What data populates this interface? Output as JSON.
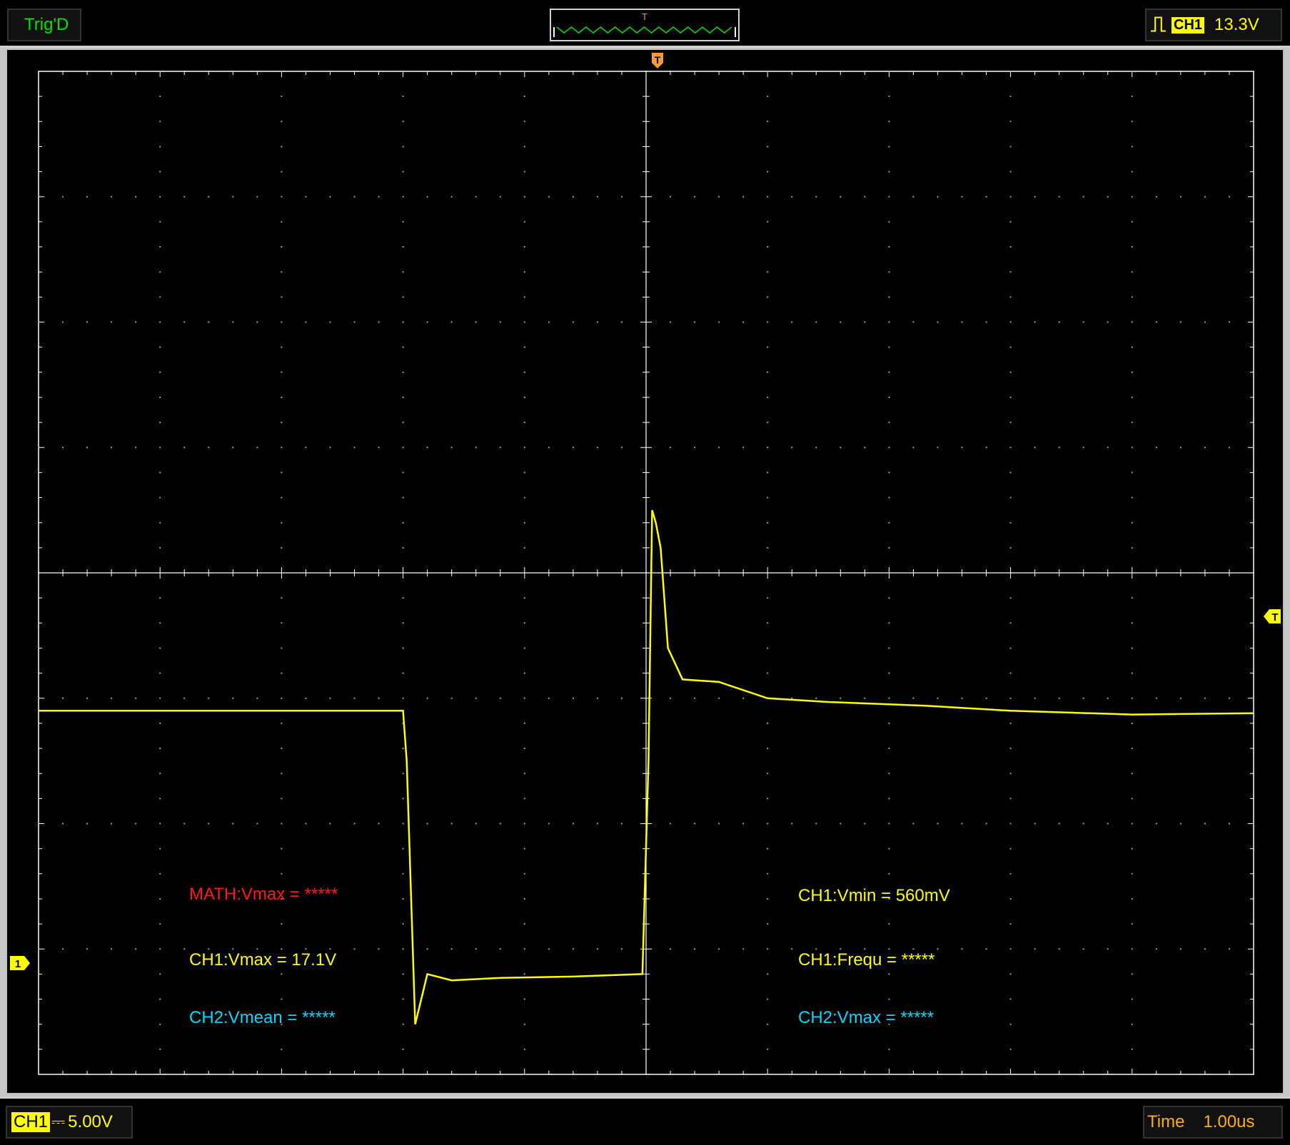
{
  "top_bar": {
    "trigger_status": "Trig'D",
    "trigger_source": "CH1",
    "trigger_level": "13.3V",
    "window_marker": "T"
  },
  "bottom_bar": {
    "channel": "CH1",
    "volts_per_div": "5.00V",
    "time_label": "Time",
    "time_per_div": "1.00us"
  },
  "markers": {
    "trigger_top": "T",
    "trigger_level": "T",
    "channel_ground": "1"
  },
  "measurements": {
    "math_vmax": "MATH:Vmax = *****",
    "ch1_vmax": "CH1:Vmax = 17.1V",
    "ch2_vmean": "CH2:Vmean = *****",
    "ch1_vmin": "CH1:Vmin = 560mV",
    "ch1_frequ": "CH1:Frequ = *****",
    "ch2_vmax": "CH2:Vmax = *****"
  },
  "colors": {
    "trace": "#ffff00",
    "grid": "#ffffff",
    "trigger_marker": "#ff9933",
    "status_green": "#00e000"
  },
  "chart_data": {
    "type": "line",
    "x_divisions": 10,
    "y_divisions": 8,
    "xlabel": "",
    "ylabel": "",
    "xlim": [
      -5,
      5
    ],
    "ylim": [
      -4,
      4
    ],
    "series": [
      {
        "x": [
          -5,
          -2.0,
          -1.97,
          -1.9,
          -1.8,
          -1.6,
          -1.2,
          -0.6,
          -0.03,
          0.02,
          0.05,
          0.08,
          0.12,
          0.18,
          0.3,
          0.6,
          1.0,
          1.5,
          2.3,
          3.0,
          4.0,
          5.0
        ],
        "y": [
          -1.1,
          -1.1,
          -1.5,
          -3.6,
          -3.2,
          -3.25,
          -3.23,
          -3.22,
          -3.2,
          -1.5,
          0.5,
          0.4,
          0.2,
          -0.6,
          -0.85,
          -0.87,
          -1.0,
          -1.03,
          -1.06,
          -1.1,
          -1.13,
          -1.12
        ]
      }
    ]
  }
}
